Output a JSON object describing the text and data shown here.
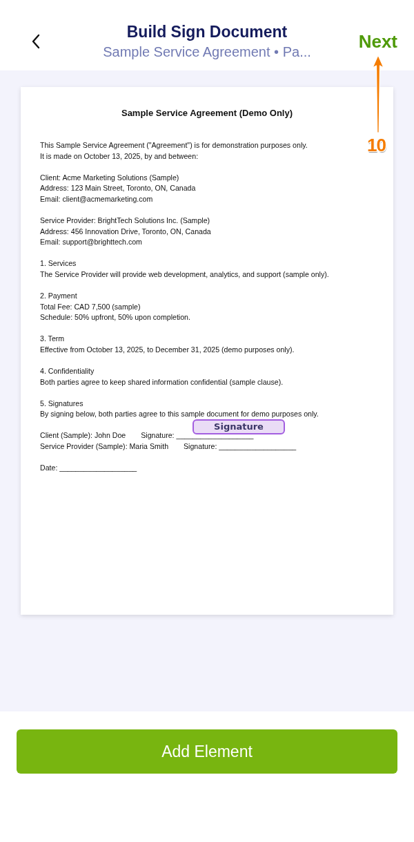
{
  "header": {
    "title": "Build Sign Document",
    "subtitle": "Sample Service Agreement • Pa...",
    "next": "Next"
  },
  "document": {
    "title": "Sample Service Agreement (Demo Only)",
    "blocks": [
      [
        "This Sample Service Agreement (\"Agreement\") is for demonstration purposes only.",
        "It is made on October 13, 2025, by and between:"
      ],
      [
        "Client: Acme Marketing Solutions (Sample)",
        "Address: 123 Main Street, Toronto, ON, Canada",
        "Email: client@acmemarketing.com"
      ],
      [
        "Service Provider: BrightTech Solutions Inc. (Sample)",
        "Address: 456 Innovation Drive, Toronto, ON, Canada",
        "Email: support@brighttech.com"
      ],
      [
        "1. Services",
        "The Service Provider will provide web development, analytics, and support (sample only)."
      ],
      [
        "2. Payment",
        "Total Fee: CAD 7,500 (sample)",
        "Schedule: 50% upfront, 50% upon completion."
      ],
      [
        "3. Term",
        "Effective from October 13, 2025, to December 31, 2025 (demo purposes only)."
      ],
      [
        "4. Confidentiality",
        "Both parties agree to keep shared information confidential (sample clause)."
      ],
      [
        "5. Signatures",
        "By signing below, both parties agree to this sample document for demo purposes only."
      ]
    ],
    "signature_rows": [
      {
        "party": "Client (Sample): John Doe",
        "signature": "Signature: ___________________"
      },
      {
        "party": "Service Provider (Sample): Maria Smith",
        "signature": "Signature: ___________________"
      }
    ],
    "date": "Date: ___________________"
  },
  "signature_field": {
    "label": "Signature"
  },
  "annotation": {
    "label": "10"
  },
  "add_button": "Add Element"
}
